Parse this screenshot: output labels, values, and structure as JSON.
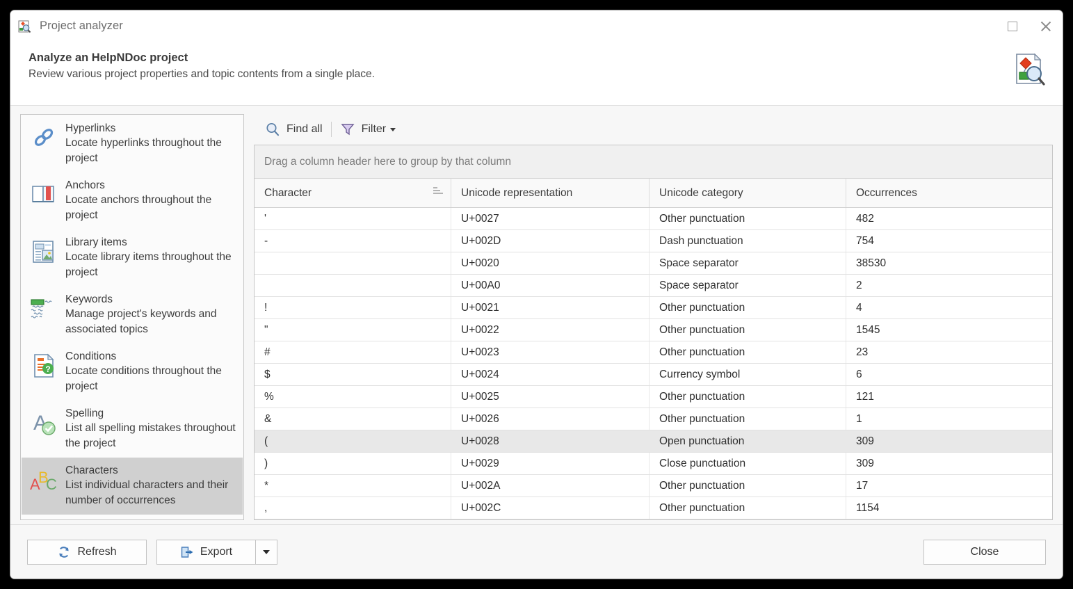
{
  "window": {
    "title": "Project analyzer",
    "app_icon": "project-analyzer-icon",
    "maximize_label": "Maximize",
    "close_label": "Close"
  },
  "header": {
    "title": "Analyze an HelpNDoc project",
    "subtitle": "Review various project properties and topic contents from a single place.",
    "icon": "project-analyzer-large-icon"
  },
  "sidebar": {
    "items": [
      {
        "icon": "hyperlinks-icon",
        "title": "Hyperlinks",
        "desc": "Locate hyperlinks throughout the project",
        "selected": false
      },
      {
        "icon": "anchors-icon",
        "title": "Anchors",
        "desc": "Locate anchors throughout the project",
        "selected": false
      },
      {
        "icon": "library-items-icon",
        "title": "Library items",
        "desc": "Locate library items throughout the project",
        "selected": false
      },
      {
        "icon": "keywords-icon",
        "title": "Keywords",
        "desc": "Manage project's keywords and associated topics",
        "selected": false
      },
      {
        "icon": "conditions-icon",
        "title": "Conditions",
        "desc": "Locate conditions throughout the project",
        "selected": false
      },
      {
        "icon": "spelling-icon",
        "title": "Spelling",
        "desc": "List all spelling mistakes throughout the project",
        "selected": false
      },
      {
        "icon": "characters-icon",
        "title": "Characters",
        "desc": "List individual characters and their number of occurrences",
        "selected": true
      }
    ]
  },
  "toolbar": {
    "find_all_label": "Find all",
    "find_all_icon": "magnifier-icon",
    "filter_label": "Filter",
    "filter_icon": "funnel-icon"
  },
  "grid": {
    "group_panel_text": "Drag a column header here to group by that column",
    "columns": [
      "Character",
      "Unicode representation",
      "Unicode category",
      "Occurrences"
    ],
    "sort_column": "Character",
    "rows": [
      {
        "character": "'",
        "unicode": "U+0027",
        "category": "Other punctuation",
        "occurrences": "482",
        "selected": false
      },
      {
        "character": "-",
        "unicode": "U+002D",
        "category": "Dash punctuation",
        "occurrences": "754",
        "selected": false
      },
      {
        "character": " ",
        "unicode": "U+0020",
        "category": "Space separator",
        "occurrences": "38530",
        "selected": false
      },
      {
        "character": " ",
        "unicode": "U+00A0",
        "category": "Space separator",
        "occurrences": "2",
        "selected": false
      },
      {
        "character": "!",
        "unicode": "U+0021",
        "category": "Other punctuation",
        "occurrences": "4",
        "selected": false
      },
      {
        "character": "\"",
        "unicode": "U+0022",
        "category": "Other punctuation",
        "occurrences": "1545",
        "selected": false
      },
      {
        "character": "#",
        "unicode": "U+0023",
        "category": "Other punctuation",
        "occurrences": "23",
        "selected": false
      },
      {
        "character": "$",
        "unicode": "U+0024",
        "category": "Currency symbol",
        "occurrences": "6",
        "selected": false
      },
      {
        "character": "%",
        "unicode": "U+0025",
        "category": "Other punctuation",
        "occurrences": "121",
        "selected": false
      },
      {
        "character": "&",
        "unicode": "U+0026",
        "category": "Other punctuation",
        "occurrences": "1",
        "selected": false
      },
      {
        "character": "(",
        "unicode": "U+0028",
        "category": "Open punctuation",
        "occurrences": "309",
        "selected": true
      },
      {
        "character": ")",
        "unicode": "U+0029",
        "category": "Close punctuation",
        "occurrences": "309",
        "selected": false
      },
      {
        "character": "*",
        "unicode": "U+002A",
        "category": "Other punctuation",
        "occurrences": "17",
        "selected": false
      },
      {
        "character": ",",
        "unicode": "U+002C",
        "category": "Other punctuation",
        "occurrences": "1154",
        "selected": false
      },
      {
        "character": "",
        "unicode": "",
        "category": "",
        "occurrences": "",
        "selected": false
      }
    ]
  },
  "footer": {
    "refresh_label": "Refresh",
    "refresh_icon": "refresh-icon",
    "export_label": "Export",
    "export_icon": "export-icon",
    "export_dropdown_icon": "chevron-down-icon",
    "close_label": "Close"
  },
  "colors": {
    "accent_blue": "#4a7ebb",
    "selection_gray": "#d0d0d0",
    "row_selection": "#e8e8e8"
  }
}
